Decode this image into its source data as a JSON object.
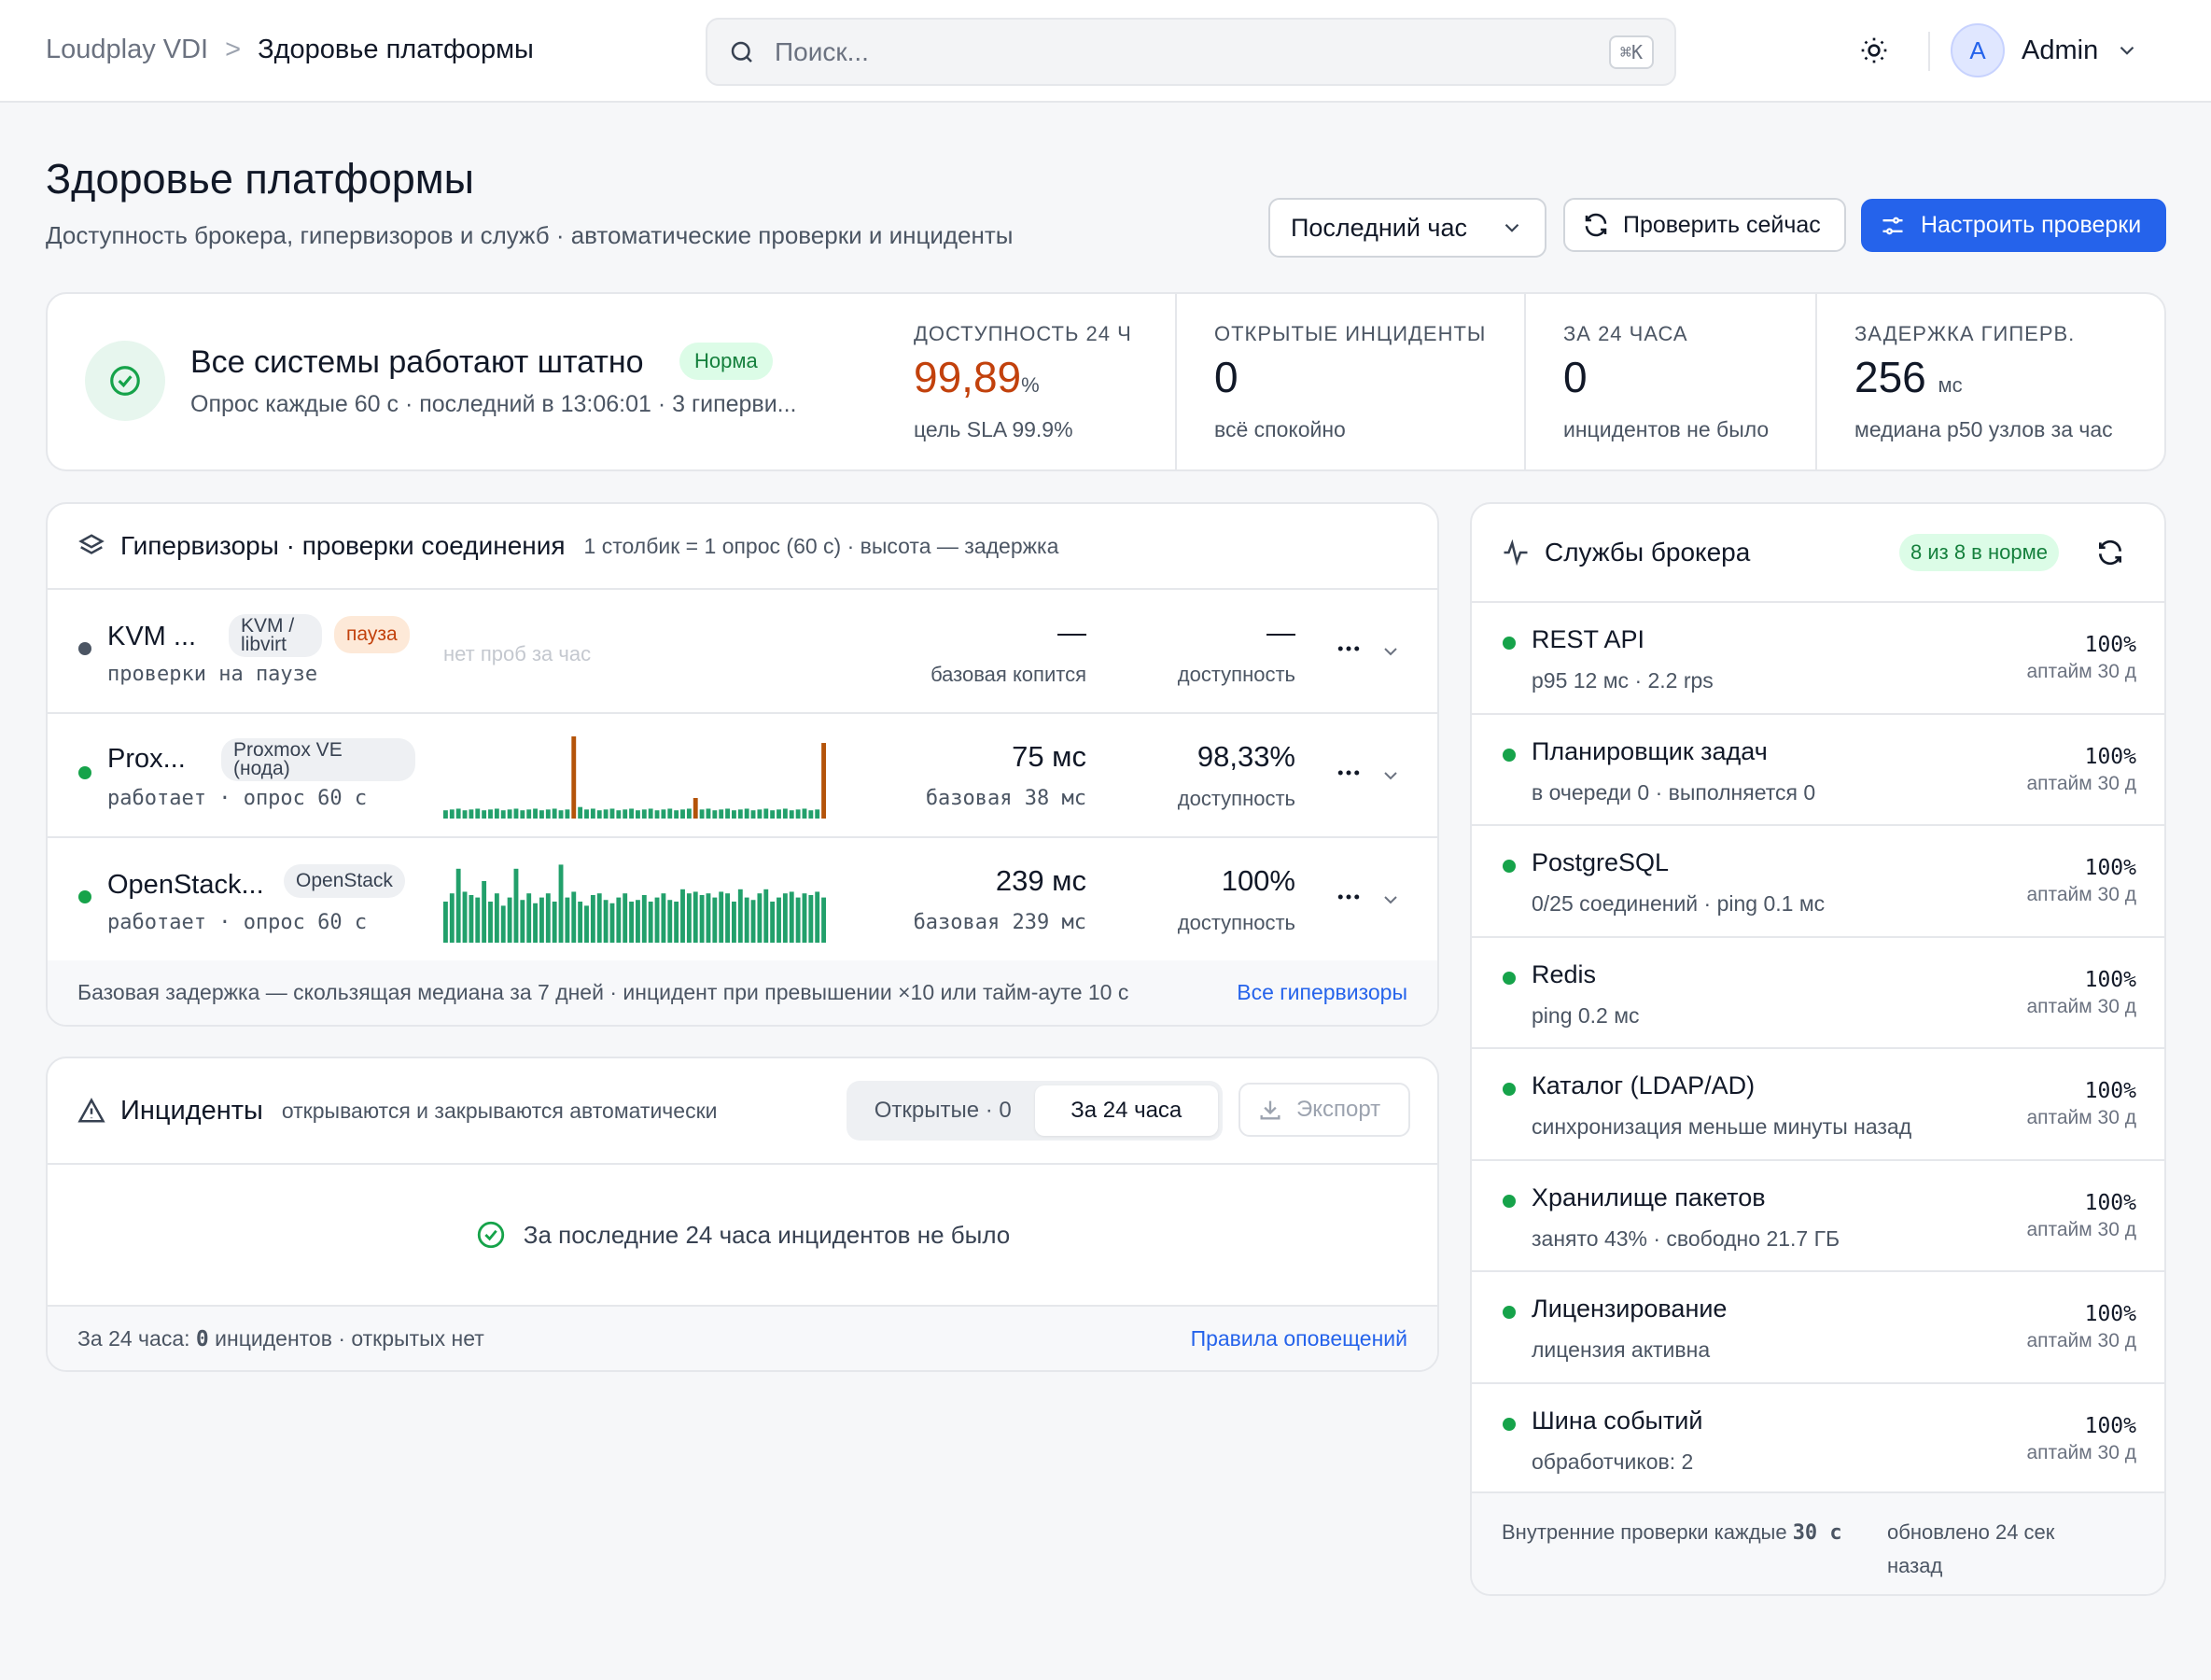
{
  "header": {
    "breadcrumb_root": "Loudplay VDI",
    "breadcrumb_sep": ">",
    "breadcrumb_current": "Здоровье платформы",
    "search_placeholder": "Поиск...",
    "search_shortcut": "⌘K",
    "user_initial": "A",
    "user_name": "Admin"
  },
  "page": {
    "title": "Здоровье платформы",
    "subtitle": "Доступность брокера, гипервизоров и служб · автоматические проверки и инциденты",
    "range_select": "Последний час",
    "check_now": "Проверить сейчас",
    "configure_checks": "Настроить проверки"
  },
  "status": {
    "title": "Все системы работают штатно",
    "badge": "Норма",
    "subtitle": "Опрос каждые 60 с · последний в 13:06:01 · 3 гиперви...",
    "metrics": [
      {
        "label": "ДОСТУПНОСТЬ 24 Ч",
        "value": "99,89",
        "unit": "%",
        "note": "цель SLA 99.9%",
        "color": "#c2410c"
      },
      {
        "label": "ОТКРЫТЫЕ ИНЦИДЕНТЫ",
        "value": "0",
        "unit": "",
        "note": "всё спокойно"
      },
      {
        "label": "ЗА 24 ЧАСА",
        "value": "0",
        "unit": "",
        "note": "инцидентов не было"
      },
      {
        "label": "ЗАДЕРЖКА ГИПЕРВ.",
        "value": "256",
        "unit": "мс",
        "note": "медиана p50 узлов за час"
      }
    ]
  },
  "hypervisors": {
    "title": "Гипервизоры · проверки соединения",
    "hint": "1 столбик = 1 опрос (60 с) · высота — задержка",
    "rows": [
      {
        "name": "KVM ...",
        "tag": "KVM / libvirt",
        "pause": "пауза",
        "sub": "проверки на паузе",
        "no_data": "нет проб за час",
        "latency": "—",
        "latency_sub": "базовая копится",
        "availability": "—",
        "availability_sub": "доступность",
        "status_color": "#4b5563"
      },
      {
        "name": "Prox...",
        "tag": "Proxmox VE (нода)",
        "sub": "работает · опрос 60 с",
        "latency": "75 мс",
        "latency_sub": "базовая 38 мс",
        "availability": "98,33%",
        "availability_sub": "доступность",
        "status_color": "#16a34a"
      },
      {
        "name": "OpenStack...",
        "tag": "OpenStack",
        "sub": "работает · опрос 60 с",
        "latency": "239 мс",
        "latency_sub": "базовая 239 мс",
        "availability": "100%",
        "availability_sub": "доступность",
        "status_color": "#16a34a"
      }
    ],
    "footer_text": "Базовая задержка — скользящая медиана за 7 дней · инцидент при превышении ×10 или тайм-ауте 10 с",
    "footer_link": "Все гипервизоры"
  },
  "incidents": {
    "title": "Инциденты",
    "hint": "открываются и закрываются автоматически",
    "tab_open": "Открытые · 0",
    "tab_24h": "За 24 часа",
    "export": "Экспорт",
    "empty_text": "За последние 24 часа инцидентов не было",
    "footer_prefix": "За 24 часа: ",
    "footer_count": "0",
    "footer_suffix": " инцидентов · открытых нет",
    "footer_link": "Правила оповещений"
  },
  "services": {
    "title": "Службы брокера",
    "badge": "8 из 8 в норме",
    "items": [
      {
        "name": "REST API",
        "desc": "p95 12 мс · 2.2 rps",
        "uptime": "100%",
        "uptime_sub": "аптайм 30 д"
      },
      {
        "name": "Планировщик задач",
        "desc": "в очереди 0 · выполняется 0",
        "uptime": "100%",
        "uptime_sub": "аптайм 30 д"
      },
      {
        "name": "PostgreSQL",
        "desc": "0/25 соединений · ping 0.1 мс",
        "uptime": "100%",
        "uptime_sub": "аптайм 30 д"
      },
      {
        "name": "Redis",
        "desc": "ping 0.2 мс",
        "uptime": "100%",
        "uptime_sub": "аптайм 30 д"
      },
      {
        "name": "Каталог (LDAP/AD)",
        "desc": "синхронизация меньше минуты назад",
        "uptime": "100%",
        "uptime_sub": "аптайм 30 д"
      },
      {
        "name": "Хранилище пакетов",
        "desc": "занято 43% · свободно 21.7 ГБ",
        "uptime": "100%",
        "uptime_sub": "аптайм 30 д"
      },
      {
        "name": "Лицензирование",
        "desc": "лицензия активна",
        "uptime": "100%",
        "uptime_sub": "аптайм 30 д"
      },
      {
        "name": "Шина событий",
        "desc": "обработчиков: 2",
        "uptime": "100%",
        "uptime_sub": "аптайм 30 д"
      }
    ],
    "footer_left_a": "Внутренние проверки каждые ",
    "footer_left_b": "30 с",
    "footer_right": "обновлено 24 сек назад"
  },
  "colors": {
    "accent": "#2563eb",
    "ok": "#16a34a",
    "warn": "#c2410c",
    "bar_ok": "#22a06b",
    "bar_spike": "#b45309"
  }
}
